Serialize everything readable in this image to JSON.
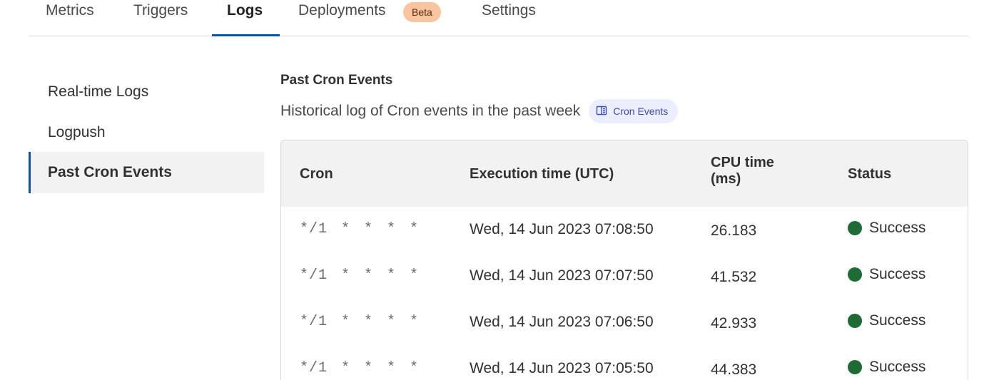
{
  "tabs": [
    {
      "label": "Metrics"
    },
    {
      "label": "Triggers"
    },
    {
      "label": "Logs",
      "active": true
    },
    {
      "label": "Deployments",
      "badge": "Beta"
    },
    {
      "label": "Settings"
    }
  ],
  "sidebar": {
    "items": [
      {
        "label": "Real-time Logs"
      },
      {
        "label": "Logpush"
      },
      {
        "label": "Past Cron Events",
        "active": true
      }
    ]
  },
  "main": {
    "title": "Past Cron Events",
    "subtitle": "Historical log of Cron events in the past week",
    "doc_link": "Cron Events"
  },
  "table": {
    "columns": {
      "cron": "Cron",
      "execution_time": "Execution time (UTC)",
      "cpu_time_line1": "CPU time",
      "cpu_time_line2": "(ms)",
      "status": "Status"
    },
    "rows": [
      {
        "cron": "*/1 * * * *",
        "execution_time": "Wed, 14 Jun 2023 07:08:50",
        "cpu_time": "26.183",
        "status": "Success"
      },
      {
        "cron": "*/1 * * * *",
        "execution_time": "Wed, 14 Jun 2023 07:07:50",
        "cpu_time": "41.532",
        "status": "Success"
      },
      {
        "cron": "*/1 * * * *",
        "execution_time": "Wed, 14 Jun 2023 07:06:50",
        "cpu_time": "42.933",
        "status": "Success"
      },
      {
        "cron": "*/1 * * * *",
        "execution_time": "Wed, 14 Jun 2023 07:05:50",
        "cpu_time": "44.383",
        "status": "Success"
      }
    ]
  },
  "colors": {
    "accent": "#0a4fb4",
    "success": "#1e6b36",
    "badge_bg": "#f8c5a0",
    "doc_pill_bg": "#eceeff"
  }
}
